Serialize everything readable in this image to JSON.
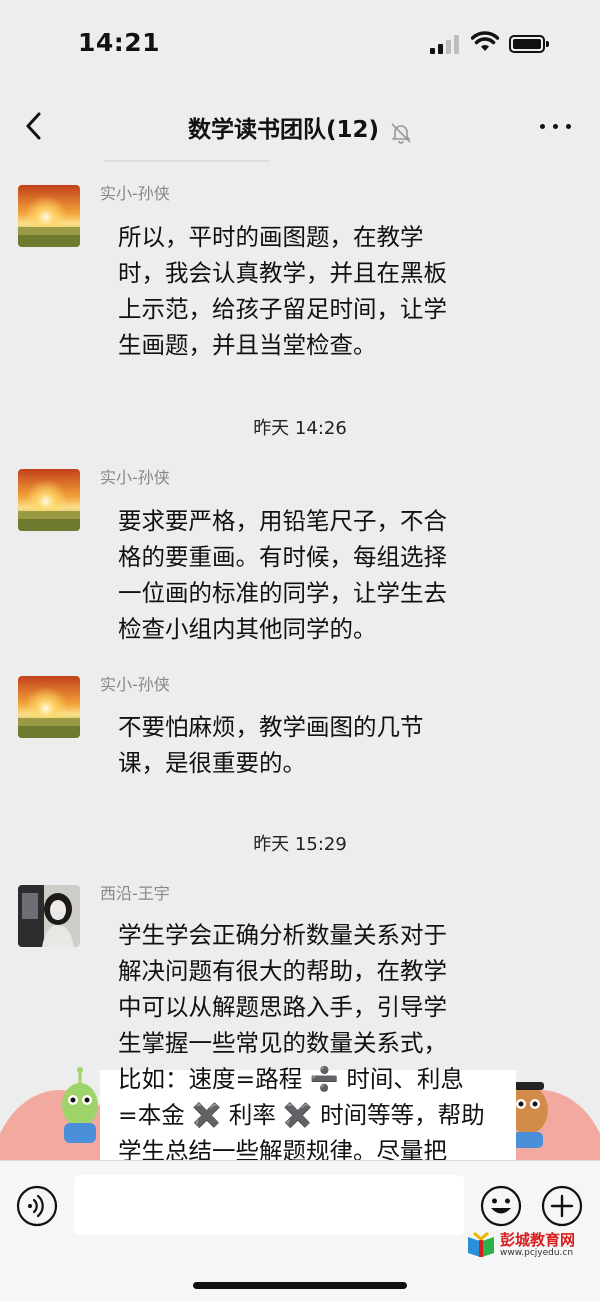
{
  "status_bar": {
    "time": "14:21"
  },
  "header": {
    "title": "数学读书团队(12)"
  },
  "messages": [
    {
      "sender": "实小-孙侠",
      "text": "所以，平时的画图题，在教学\n时，我会认真教学，并且在黑板\n上示范，给孩子留足时间，让学\n生画题，并且当堂检查。"
    },
    {
      "sender": "实小-孙侠",
      "text": "要求要严格，用铅笔尺子，不合\n格的要重画。有时候，每组选择\n一位画的标准的同学，让学生去\n检查小组内其他同学的。"
    },
    {
      "sender": "实小-孙侠",
      "text": "不要怕麻烦，教学画图的几节\n课，是很重要的。"
    },
    {
      "sender": "西沿-王宇",
      "text": "学生学会正确分析数量关系对于\n解决问题有很大的帮助，在教学\n中可以从解题思路入手，引导学\n生掌握一些常见的数量关系式，\n比如：速度=路程 ➗ 时间、利息\n=本金 ✖️ 利率 ✖️ 时间等等，帮助\n学生总结一些解题规律。尽量把\n数量关系渗透在平常的教学中"
    }
  ],
  "timestamps": [
    "昨天 14:26",
    "昨天 15:29"
  ],
  "watermark": {
    "title": "彭城教育网",
    "url": "www.pcjyedu.cn"
  }
}
